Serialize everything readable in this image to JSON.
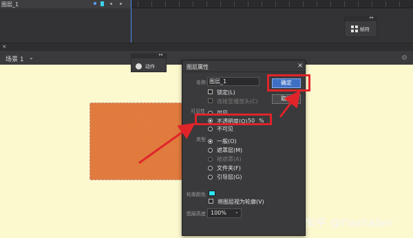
{
  "timeline": {
    "layer_name": "图层_1"
  },
  "frames_panel": {
    "label": "帧符",
    "icon": "frames-grid-icon",
    "collapse_glyph": "▸▸"
  },
  "actions_panel": {
    "label": "动作",
    "icon": "actions-icon",
    "collapse_glyph": "▸▸"
  },
  "scene_bar": {
    "close_glyph": "×",
    "scene_label": "场景 1",
    "caret": "⌄",
    "settings_icon": "gear-icon"
  },
  "dialog": {
    "title": "图层属性",
    "close": "×",
    "name_label": "名称:",
    "name_value": "图层_1",
    "ok_label": "确定",
    "cancel_label": "取消",
    "lock_label": "锁定(L)",
    "link_label": "连接至播放头(C)",
    "visibility_label": "可见性",
    "visibility_options": [
      "可见",
      "不透明度(O)",
      "不可见"
    ],
    "opacity_value": "50",
    "opacity_unit": "%",
    "type_label": "类型",
    "type_options": [
      "一般(O)",
      "遮罩层(M)",
      "被遮罩(A)",
      "文件夹(F)",
      "引导层(G)"
    ],
    "outline_color_label": "轮廓颜色",
    "outline_color": "#2fe3f0",
    "outline_checkbox_label": "将图层视为轮廓(V)",
    "height_label": "图层高度",
    "height_value": "100%"
  },
  "colors": {
    "highlight": "#e0242a",
    "stage": "#fdf9cf",
    "shape": "#e0783a"
  },
  "watermark": "知乎 @FlashASer"
}
